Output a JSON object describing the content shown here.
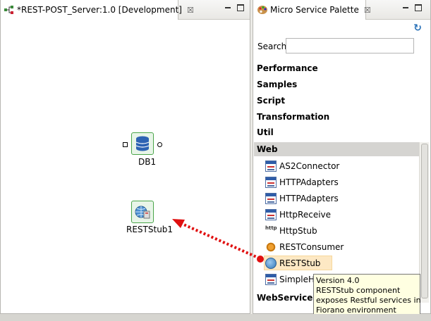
{
  "editor": {
    "tab_title": "*REST-POST_Server:1.0 [Development]",
    "close_glyph": "☒",
    "nodes": [
      {
        "label": "DB1",
        "icon": "database-icon"
      },
      {
        "label": "RESTStub1",
        "icon": "globe-server-icon"
      }
    ]
  },
  "palette": {
    "tab_title": "Micro Service Palette",
    "close_glyph": "☒",
    "refresh_glyph": "↻",
    "search_label": "Search",
    "search_value": "",
    "categories": [
      {
        "label": "Performance"
      },
      {
        "label": "Samples"
      },
      {
        "label": "Script"
      },
      {
        "label": "Transformation"
      },
      {
        "label": "Util"
      },
      {
        "label": "Web"
      },
      {
        "label": "WebService"
      }
    ],
    "web_items": [
      {
        "label": "AS2Connector",
        "icon": "table-icon"
      },
      {
        "label": "HTTPAdapters",
        "icon": "table-icon"
      },
      {
        "label": "HTTPAdapters",
        "icon": "table-icon"
      },
      {
        "label": "HttpReceive",
        "icon": "table-icon"
      },
      {
        "label": "HttpStub",
        "icon": "http-icon"
      },
      {
        "label": "RESTConsumer",
        "icon": "gear-icon"
      },
      {
        "label": "RESTStub",
        "icon": "globe-icon"
      },
      {
        "label": "SimpleHT",
        "icon": "table-icon"
      }
    ],
    "http_glyph": "http"
  },
  "tooltip": {
    "line1": "Version 4.0",
    "line2": "RESTStub component",
    "line3": "exposes Restful services in",
    "line4": "Fiorano environment"
  },
  "colors": {
    "drag_arrow": "#e01010",
    "selection": "#fde8c4",
    "node_border": "#4aa54a"
  }
}
